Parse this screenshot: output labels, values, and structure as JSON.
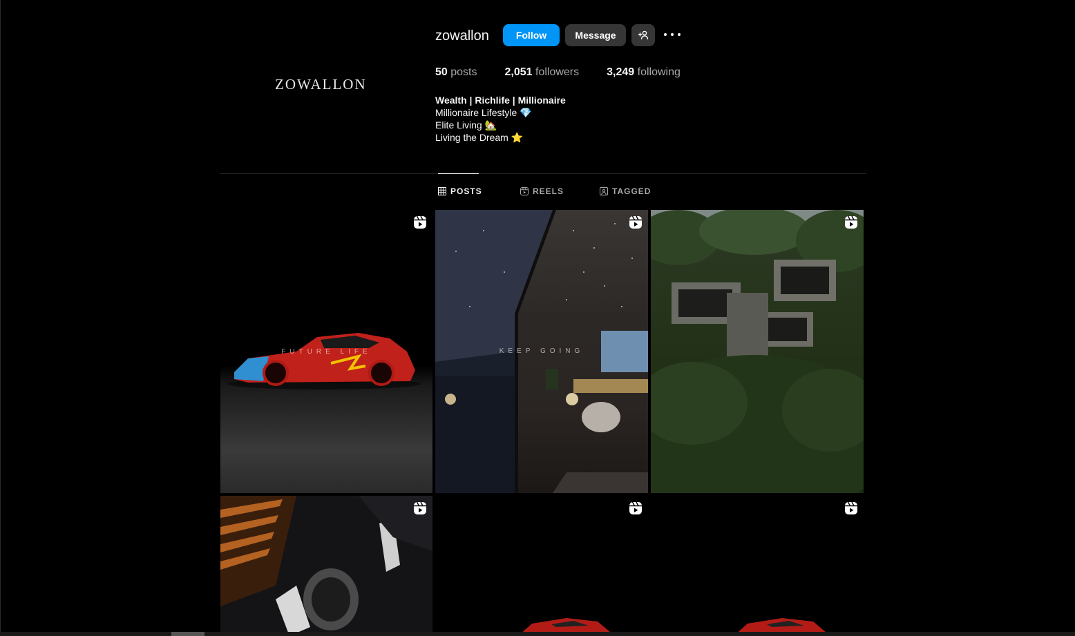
{
  "profile": {
    "logo_text": "ZOWALLON",
    "username": "zowallon",
    "follow_label": "Follow",
    "message_label": "Message",
    "posts_count": "50",
    "posts_label": "posts",
    "followers_count": "2,051",
    "followers_label": "followers",
    "following_count": "3,249",
    "following_label": "following",
    "bio": {
      "name": "Wealth | Richlife | Millionaire",
      "line1": "Millionaire Lifestyle 💎",
      "line2": "Elite Living 🏡",
      "line3": "Living the Dream ⭐"
    }
  },
  "tabs": [
    {
      "label": "POSTS",
      "icon": "grid-icon",
      "active": true
    },
    {
      "label": "REELS",
      "icon": "reels-icon",
      "active": false
    },
    {
      "label": "TAGGED",
      "icon": "tagged-icon",
      "active": false
    }
  ],
  "posts": [
    {
      "icon": "reel-icon",
      "overlay_text": "FUTURE LIFE"
    },
    {
      "icon": "reel-icon",
      "overlay_text": "KEEP GOING"
    },
    {
      "icon": "reel-icon"
    },
    {
      "icon": "reel-icon"
    },
    {
      "icon": "reel-icon"
    },
    {
      "icon": "reel-icon"
    }
  ],
  "colors": {
    "background": "#000000",
    "follow_button": "#0095f6",
    "secondary_button": "#363636",
    "text_primary": "#f5f5f5",
    "text_secondary": "#a8a8a8"
  }
}
